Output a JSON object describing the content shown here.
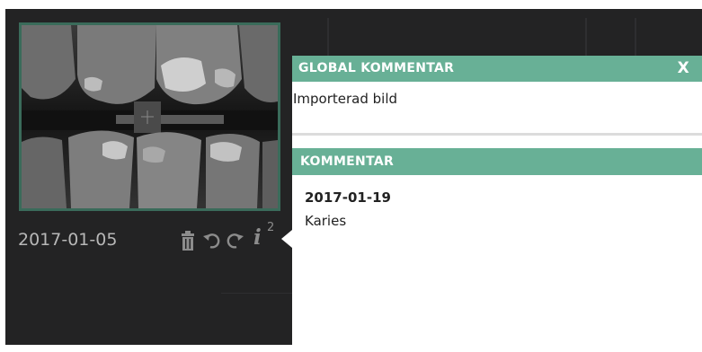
{
  "thumbnail": {
    "date": "2017-01-05",
    "info_count": "2",
    "icons": [
      "trash-icon",
      "undo-icon",
      "redo-icon",
      "info-icon"
    ]
  },
  "global_comment": {
    "title": "GLOBAL KOMMENTAR",
    "close_label": "X",
    "text": "Importerad bild"
  },
  "comment": {
    "title": "KOMMENTAR",
    "date": "2017-01-19",
    "text": "Karies"
  },
  "colors": {
    "accent": "#68b096",
    "frame": "#3a6b5a",
    "background": "#232324"
  }
}
